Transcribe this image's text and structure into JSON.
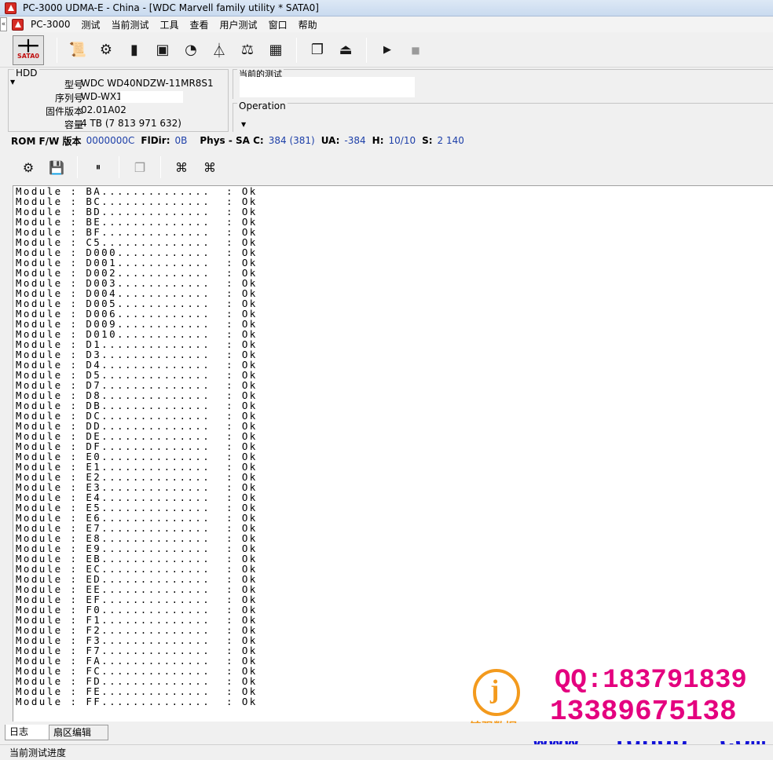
{
  "window": {
    "title": "PC-3000 UDMA-E - China - [WDC Marvell family utility * SATA0]"
  },
  "menu": {
    "collapse": "«",
    "items": [
      "PC-3000",
      "测试",
      "当前测试",
      "工具",
      "查看",
      "用户测试",
      "窗口",
      "帮助"
    ]
  },
  "toolbar": {
    "sata_label": "SATA0",
    "buttons": [
      "document-icon",
      "gear-icon",
      "chip-icon",
      "board-icon",
      "drive-icon",
      "flask-icon",
      "balance-icon",
      "grid-icon",
      "windows-icon",
      "exit-icon",
      "play-icon",
      "stop-icon"
    ]
  },
  "hdd": {
    "legend": "HDD",
    "rows": [
      {
        "label": "型号",
        "value": "WDC WD40NDZW-11MR8S1"
      },
      {
        "label": "序列号",
        "value": "WD-WX1          S"
      },
      {
        "label": "固件版本",
        "value": "02.01A02"
      },
      {
        "label": "容量",
        "value": "4 TB (7 813 971 632)"
      }
    ]
  },
  "current_test": {
    "label": "当前的测试"
  },
  "operation": {
    "label": "Operation"
  },
  "statusline": {
    "rom_label": "ROM F/W 版本",
    "rom_value": "0000000C",
    "fldir_label": "FlDir:",
    "fldir_value": "0B",
    "phys_label": "Phys - SA C:",
    "phys_value": "384 (381)",
    "ua_label": "UA:",
    "ua_value": "-384",
    "h_label": "H:",
    "h_value": "10/10",
    "s_label": "S:",
    "s_value": "2 140"
  },
  "log": {
    "lines": [
      "Module : BA..............  : Ok",
      "Module : BC..............  : Ok",
      "Module : BD..............  : Ok",
      "Module : BE..............  : Ok",
      "Module : BF..............  : Ok",
      "Module : C5..............  : Ok",
      "Module : D000............  : Ok",
      "Module : D001............  : Ok",
      "Module : D002............  : Ok",
      "Module : D003............  : Ok",
      "Module : D004............  : Ok",
      "Module : D005............  : Ok",
      "Module : D006............  : Ok",
      "Module : D009............  : Ok",
      "Module : D010............  : Ok",
      "Module : D1..............  : Ok",
      "Module : D3..............  : Ok",
      "Module : D4..............  : Ok",
      "Module : D5..............  : Ok",
      "Module : D7..............  : Ok",
      "Module : D8..............  : Ok",
      "Module : DB..............  : Ok",
      "Module : DC..............  : Ok",
      "Module : DD..............  : Ok",
      "Module : DE..............  : Ok",
      "Module : DF..............  : Ok",
      "Module : E0..............  : Ok",
      "Module : E1..............  : Ok",
      "Module : E2..............  : Ok",
      "Module : E3..............  : Ok",
      "Module : E4..............  : Ok",
      "Module : E5..............  : Ok",
      "Module : E6..............  : Ok",
      "Module : E7..............  : Ok",
      "Module : E8..............  : Ok",
      "Module : E9..............  : Ok",
      "Module : EB..............  : Ok",
      "Module : EC..............  : Ok",
      "Module : ED..............  : Ok",
      "Module : EE..............  : Ok",
      "Module : EF..............  : Ok",
      "Module : F0..............  : Ok",
      "Module : F1..............  : Ok",
      "Module : F2..............  : Ok",
      "Module : F3..............  : Ok",
      "Module : F7..............  : Ok",
      "Module : FA..............  : Ok",
      "Module : FC..............  : Ok",
      "Module : FD..............  : Ok",
      "Module : FE..............  : Ok",
      "Module : FF..............  : Ok"
    ]
  },
  "tabs": [
    "日志",
    "扇区编辑"
  ],
  "status_bottom": "当前测试进度",
  "watermark": {
    "logo_letter": "j",
    "name": "锦强数据",
    "qq": "QQ:183791839",
    "phone": "13389675138",
    "url": "www. jqhdd. com",
    "pink": "#e4007f",
    "blue": "#1212d8",
    "orange": "#f39a1d"
  }
}
